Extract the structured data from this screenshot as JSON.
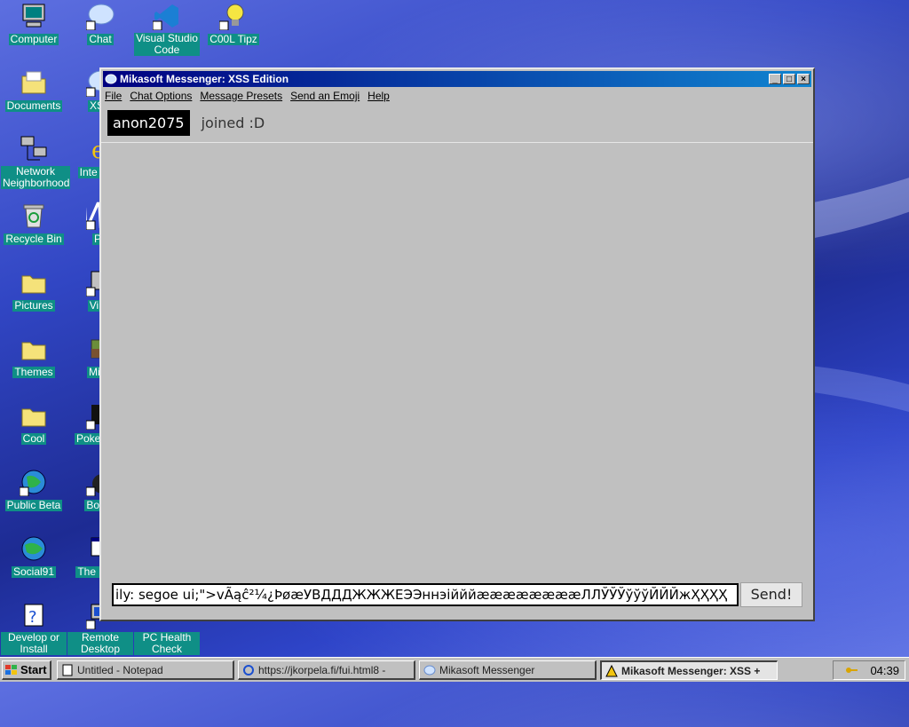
{
  "desktop": {
    "icons": [
      {
        "label": "Computer",
        "icon": "computer-icon"
      },
      {
        "label": "Chat",
        "icon": "chat-bubble-icon"
      },
      {
        "label": "Visual Studio Code",
        "icon": "vscode-icon"
      },
      {
        "label": "C00L Tipz",
        "icon": "tips-icon"
      },
      {
        "label": "Documents",
        "icon": "documents-folder-icon"
      },
      {
        "label": "XSS",
        "icon": "xss-icon"
      },
      {
        "label": "Network Neighborhood",
        "icon": "network-icon"
      },
      {
        "label": "Inte Expl",
        "icon": "internet-explorer-icon"
      },
      {
        "label": "Recycle Bin",
        "icon": "recycle-bin-icon"
      },
      {
        "label": "Ps",
        "icon": "ps-icon"
      },
      {
        "label": "Pictures",
        "icon": "pictures-folder-icon"
      },
      {
        "label": "Virtu",
        "icon": "virtual-icon"
      },
      {
        "label": "Themes",
        "icon": "themes-folder-icon"
      },
      {
        "label": "Mine",
        "icon": "minecraft-icon"
      },
      {
        "label": "Cool",
        "icon": "cool-folder-icon"
      },
      {
        "label": "Poke Plati",
        "icon": "pokemon-icon"
      },
      {
        "label": "Public Beta",
        "icon": "public-beta-icon"
      },
      {
        "label": "Bomb",
        "icon": "bomb-icon"
      },
      {
        "label": "Social91",
        "icon": "social91-icon"
      },
      {
        "label": "The Desk",
        "icon": "desk-icon"
      },
      {
        "label": "Develop or Install",
        "icon": "develop-icon"
      },
      {
        "label": "Remote Desktop",
        "icon": "remote-desktop-icon"
      },
      {
        "label": "PC Health Check",
        "icon": "pc-health-icon"
      }
    ]
  },
  "window": {
    "title": "Mikasoft Messenger: XSS Edition",
    "controls": {
      "minimize": "_",
      "maximize": "□",
      "close": "×"
    },
    "menu": [
      "File",
      "Chat Options",
      "Message Presets",
      "Send an Emoji",
      "Help"
    ],
    "messages": [
      {
        "user": "anon2075",
        "text": "joined :D"
      }
    ],
    "input_value": "ily: segoe ui;\">vÃąĉ²¼¿ÞøæУВДДДЖЖЖЕЭЭннэійййææææææææЛЛЎЎЎўўўЙЙЙжҲҲҲҲ",
    "send_label": "Send!"
  },
  "taskbar": {
    "start_label": "Start",
    "tasks": [
      {
        "label": "Untitled - Notepad",
        "active": false
      },
      {
        "label": "https://jkorpela.fi/fui.html8 -",
        "active": false
      },
      {
        "label": "Mikasoft Messenger",
        "active": false
      },
      {
        "label": "Mikasoft Messenger: XSS +",
        "active": true
      }
    ],
    "clock": "04:39"
  }
}
